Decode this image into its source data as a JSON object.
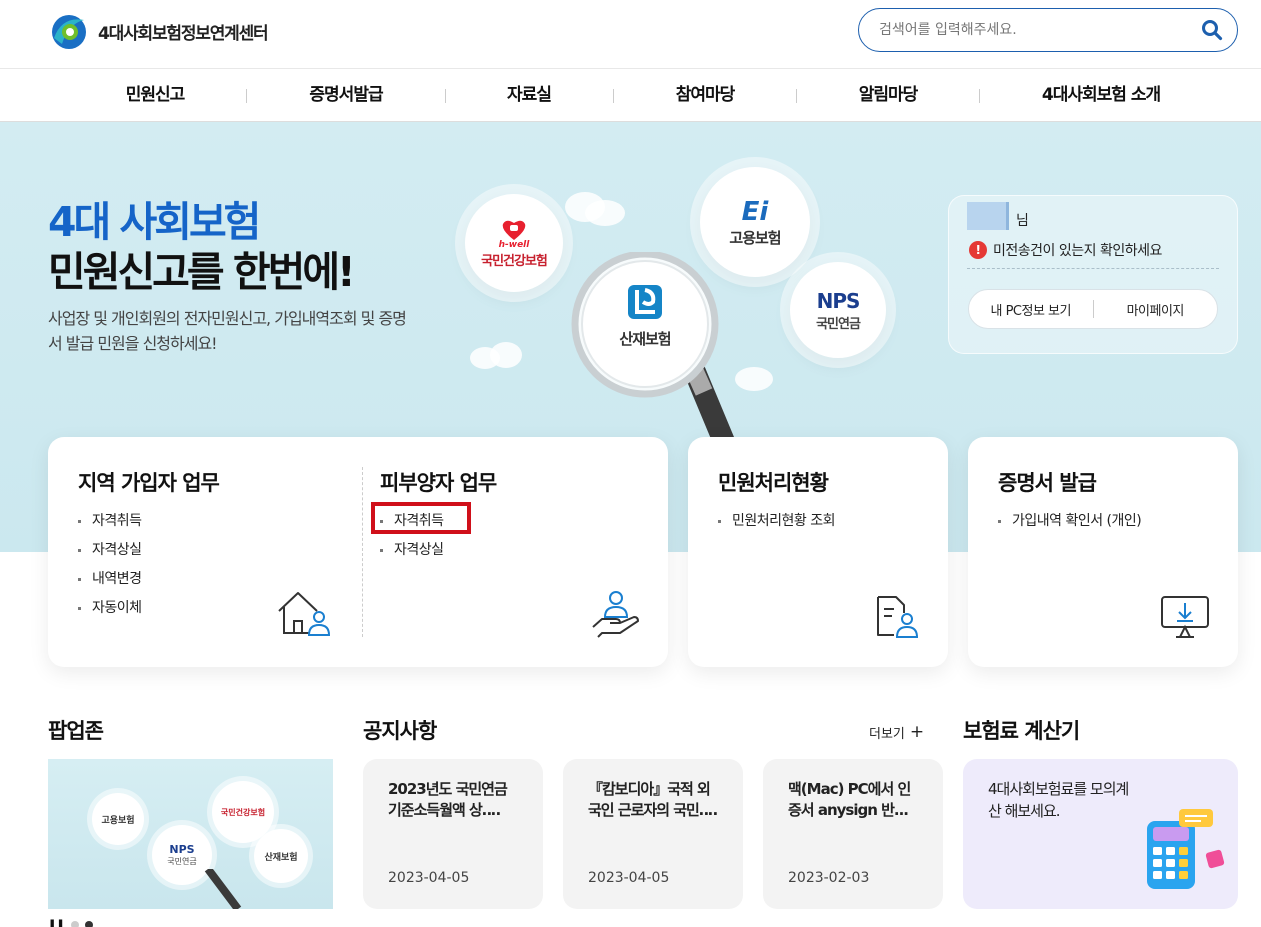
{
  "header": {
    "logo_text": "4대사회보험정보연계센터",
    "search_placeholder": "검색어를 입력해주세요."
  },
  "gnb": [
    "민원신고",
    "증명서발급",
    "자료실",
    "참여마당",
    "알림마당",
    "4대사회보험 소개"
  ],
  "hero": {
    "title_line1": "4대 사회보험",
    "title_line2": "민원신고를 한번에!",
    "description": "사업장 및 개인회원의 전자민원신고, 가입내역조회 및 증명서 발급 민원을 신청하세요!",
    "bubbles": {
      "health_brand": "h-well",
      "health": "국민건강보험",
      "employment_mark": "Ei",
      "employment": "고용보험",
      "industrial": "산재보험",
      "pension_brand": "NPS",
      "pension": "국민연금"
    }
  },
  "user_panel": {
    "suffix": "님",
    "alert": "미전송건이 있는지 확인하세요",
    "buttons": [
      "내 PC정보 보기",
      "마이페이지"
    ]
  },
  "cards": {
    "regional": {
      "title": "지역 가입자 업무",
      "items": [
        "자격취득",
        "자격상실",
        "내역변경",
        "자동이체"
      ]
    },
    "dependent": {
      "title": "피부양자 업무",
      "items": [
        "자격취득",
        "자격상실"
      ]
    },
    "status": {
      "title": "민원처리현황",
      "items": [
        "민원처리현황 조회"
      ]
    },
    "certificate": {
      "title": "증명서 발급",
      "items": [
        "가입내역 확인서 (개인)"
      ]
    }
  },
  "bottom": {
    "popup_title": "팝업존",
    "notice_title": "공지사항",
    "more": "더보기",
    "calc_title": "보험료 계산기",
    "calc_desc": "4대사회보험료를 모의계산 해보세요.",
    "notices": [
      {
        "title": "2023년도 국민연금 기준소득월액 상‥‥",
        "date": "2023-04-05"
      },
      {
        "title": "『캄보디아』국적 외국인 근로자의 국민‥‥",
        "date": "2023-04-05"
      },
      {
        "title": "맥(Mac) PC에서 인증서 anysign 반...",
        "date": "2023-02-03"
      }
    ],
    "popup_labels": {
      "employment": "고용보험",
      "health": "국민건강보험",
      "pension_brand": "NPS",
      "pension": "국민연금",
      "industrial": "산재보험"
    }
  }
}
